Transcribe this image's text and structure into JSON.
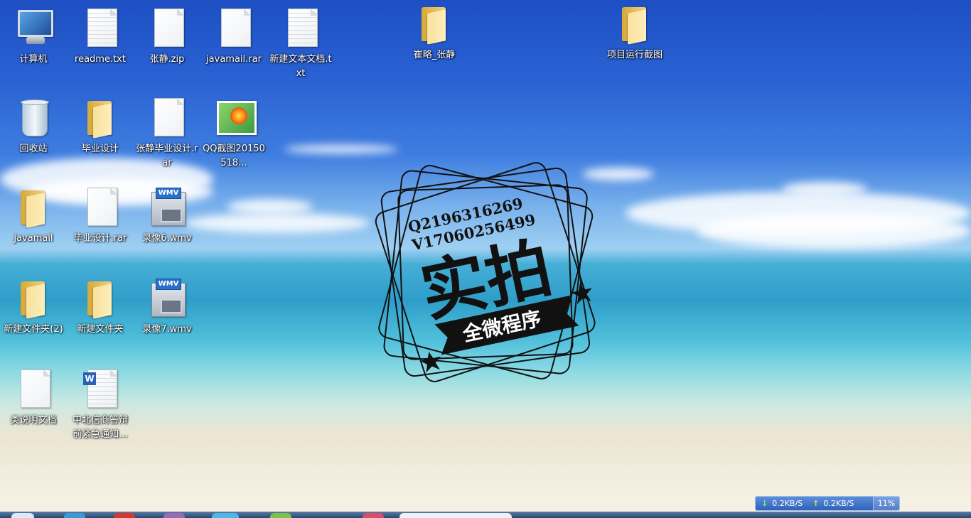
{
  "desktop_icons": [
    {
      "label": "计算机",
      "icon": "computer-icon"
    },
    {
      "label": "readme.txt",
      "icon": "text-file-icon"
    },
    {
      "label": "张静.zip",
      "icon": "file-icon"
    },
    {
      "label": "javamail.rar",
      "icon": "file-icon"
    },
    {
      "label": "新建文本文档.txt",
      "icon": "text-file-icon"
    },
    {
      "label": "崔略_张静",
      "icon": "folder-icon"
    },
    {
      "label": "项目运行截图",
      "icon": "folder-icon"
    },
    {
      "label": "回收站",
      "icon": "recycle-bin-icon"
    },
    {
      "label": "毕业设计",
      "icon": "folder-icon"
    },
    {
      "label": "张静毕业设计.rar",
      "icon": "file-icon"
    },
    {
      "label": "QQ截图20150518...",
      "icon": "image-file-icon"
    },
    {
      "label": "javamail",
      "icon": "folder-icon"
    },
    {
      "label": "毕业设计.rar",
      "icon": "file-icon"
    },
    {
      "label": "录像6.wmv",
      "icon": "video-file-icon"
    },
    {
      "label": "新建文件夹(2)",
      "icon": "folder-icon"
    },
    {
      "label": "新建文件夹",
      "icon": "folder-icon"
    },
    {
      "label": "录像7.wmv",
      "icon": "video-file-icon"
    },
    {
      "label": "类说明文档",
      "icon": "file-icon"
    },
    {
      "label": "中北信商答辩前紧急通知...",
      "icon": "word-document-icon"
    }
  ],
  "watermark": {
    "line1": "Q2196316269",
    "line2": "V17060256499",
    "title": "实拍",
    "ribbon": "全微程序"
  },
  "netmeter": {
    "download": "0.2KB/S",
    "upload": "0.2KB/S",
    "percent": "11%",
    "download_color": "#7ff07f",
    "upload_color": "#ffd54a"
  },
  "wmv_badge": "WMV",
  "word_badge": "W"
}
